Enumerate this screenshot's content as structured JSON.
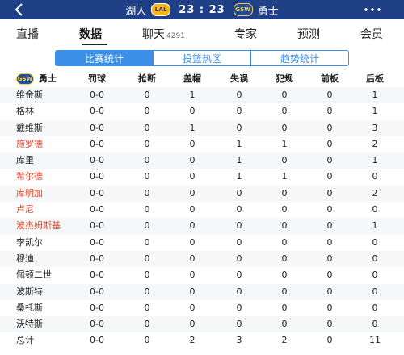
{
  "topbar": {
    "home_team": "湖人",
    "home_logo": "LAL",
    "score": "23 : 23",
    "away_logo": "GSW",
    "away_team": "勇士",
    "bg_color": "#1f3f86"
  },
  "tabs": [
    {
      "label": "直播"
    },
    {
      "label": "数据"
    },
    {
      "label": "聊天",
      "count": "4291"
    },
    {
      "label": "专家"
    },
    {
      "label": "预测"
    },
    {
      "label": "会员"
    }
  ],
  "segments": [
    "比赛统计",
    "投篮热区",
    "趋势统计"
  ],
  "table": {
    "team_logo": "GSW",
    "team_name": "勇士",
    "columns": [
      "罚球",
      "抢断",
      "盖帽",
      "失误",
      "犯规",
      "前板",
      "后板"
    ],
    "rows": [
      {
        "name": "维金斯",
        "red": false,
        "v": [
          "0-0",
          "0",
          "1",
          "0",
          "0",
          "0",
          "1"
        ]
      },
      {
        "name": "格林",
        "red": false,
        "v": [
          "0-0",
          "0",
          "0",
          "0",
          "0",
          "0",
          "1"
        ]
      },
      {
        "name": "戴维斯",
        "red": false,
        "v": [
          "0-0",
          "0",
          "1",
          "0",
          "0",
          "0",
          "3"
        ]
      },
      {
        "name": "施罗德",
        "red": true,
        "v": [
          "0-0",
          "0",
          "0",
          "1",
          "1",
          "0",
          "2"
        ]
      },
      {
        "name": "库里",
        "red": false,
        "v": [
          "0-0",
          "0",
          "0",
          "1",
          "0",
          "0",
          "1"
        ]
      },
      {
        "name": "希尔德",
        "red": true,
        "v": [
          "0-0",
          "0",
          "0",
          "1",
          "1",
          "0",
          "0"
        ]
      },
      {
        "name": "库明加",
        "red": true,
        "v": [
          "0-0",
          "0",
          "0",
          "0",
          "0",
          "0",
          "2"
        ]
      },
      {
        "name": "卢尼",
        "red": true,
        "v": [
          "0-0",
          "0",
          "0",
          "0",
          "0",
          "0",
          "0"
        ]
      },
      {
        "name": "波杰姆斯基",
        "red": true,
        "v": [
          "0-0",
          "0",
          "0",
          "0",
          "0",
          "0",
          "1"
        ]
      },
      {
        "name": "李凯尔",
        "red": false,
        "v": [
          "0-0",
          "0",
          "0",
          "0",
          "0",
          "0",
          "0"
        ]
      },
      {
        "name": "穆迪",
        "red": false,
        "v": [
          "0-0",
          "0",
          "0",
          "0",
          "0",
          "0",
          "0"
        ]
      },
      {
        "name": "佩顿二世",
        "red": false,
        "v": [
          "0-0",
          "0",
          "0",
          "0",
          "0",
          "0",
          "0"
        ]
      },
      {
        "name": "波斯特",
        "red": false,
        "v": [
          "0-0",
          "0",
          "0",
          "0",
          "0",
          "0",
          "0"
        ]
      },
      {
        "name": "桑托斯",
        "red": false,
        "v": [
          "0-0",
          "0",
          "0",
          "0",
          "0",
          "0",
          "0"
        ]
      },
      {
        "name": "沃特斯",
        "red": false,
        "v": [
          "0-0",
          "0",
          "0",
          "0",
          "0",
          "0",
          "0"
        ]
      },
      {
        "name": "总计",
        "red": false,
        "v": [
          "0-0",
          "0",
          "2",
          "3",
          "2",
          "0",
          "11"
        ]
      }
    ]
  }
}
